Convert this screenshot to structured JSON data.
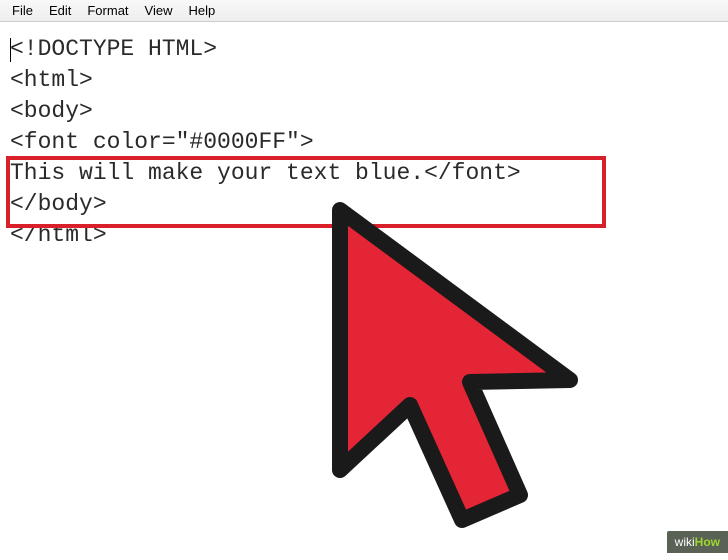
{
  "menubar": {
    "items": [
      "File",
      "Edit",
      "Format",
      "View",
      "Help"
    ]
  },
  "code": {
    "lines": [
      "<!DOCTYPE HTML>",
      "<html>",
      "<body>",
      "",
      "<font color=\"#0000FF\">",
      "This will make your text blue.</font>",
      "",
      "</body>",
      "</html>"
    ]
  },
  "watermark": {
    "prefix": "wiki",
    "suffix": "How"
  },
  "highlight": {
    "color": "#d91f2a"
  },
  "cursor_icon": {
    "fill": "#e42535",
    "stroke": "#1a1a1a"
  }
}
